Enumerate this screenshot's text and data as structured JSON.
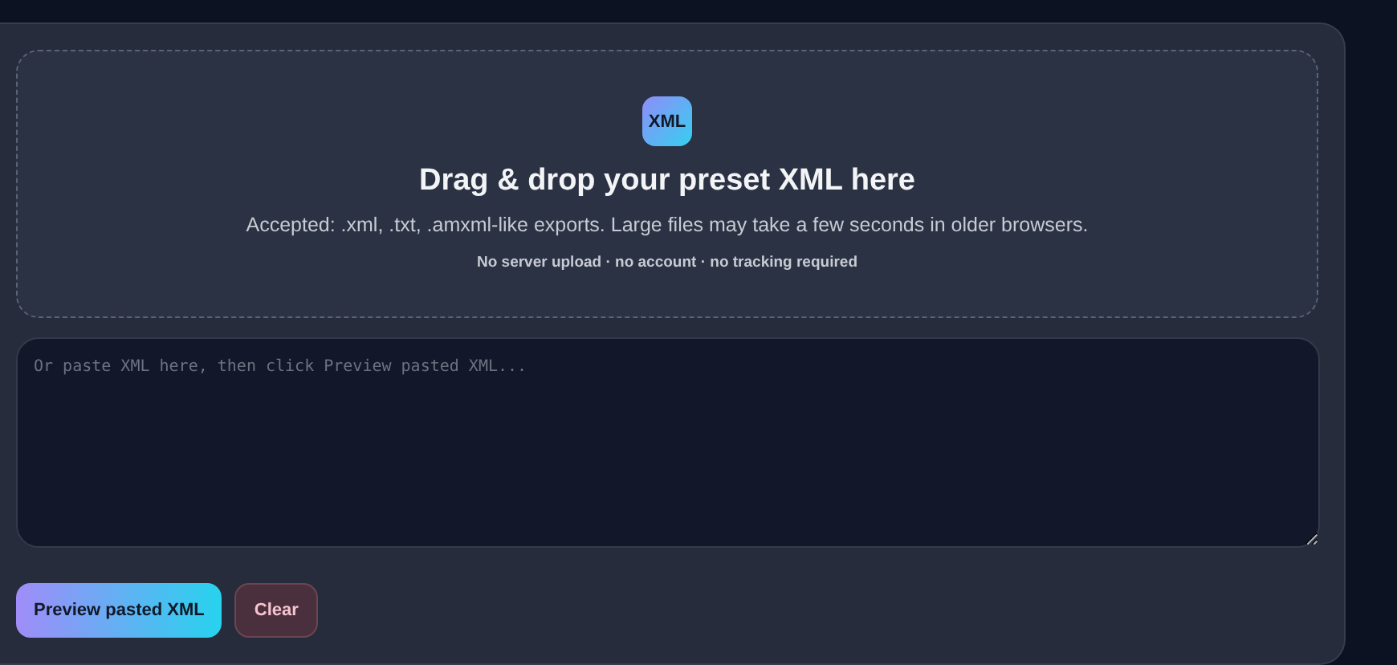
{
  "dropzone": {
    "badge": "XML",
    "title": "Drag & drop your preset XML here",
    "description": "Accepted: .xml, .txt, .amxml-like exports. Large files may take a few seconds in older browsers.",
    "note": "No server upload · no account · no tracking required"
  },
  "paste_field": {
    "placeholder": "Or paste XML here, then click Preview pasted XML..."
  },
  "buttons": [
    {
      "label": "Preview pasted XML",
      "kind": "primary"
    },
    {
      "label": "Clear",
      "kind": "danger"
    }
  ]
}
